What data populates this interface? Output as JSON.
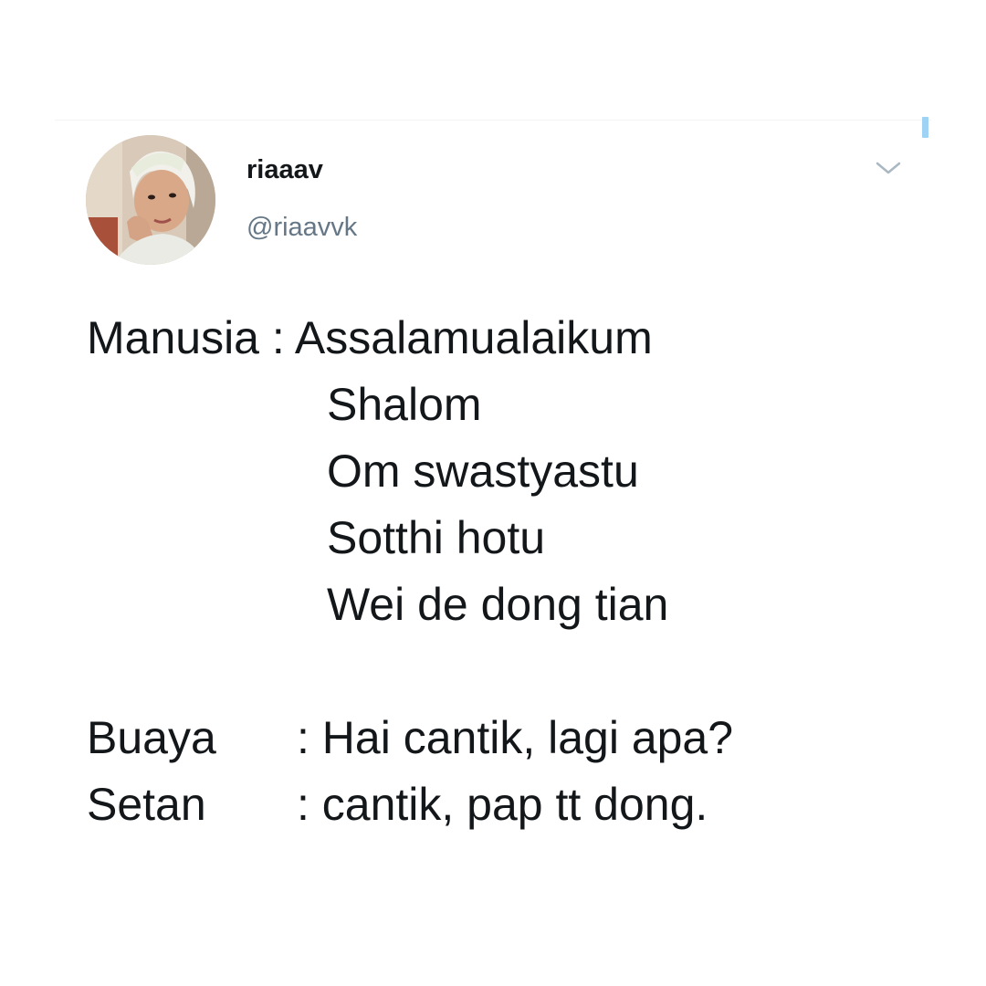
{
  "user": {
    "display_name": "riaaav",
    "handle": "@riaavvk",
    "avatar_icon": "profile-photo"
  },
  "controls": {
    "more_icon": "chevron-down-icon",
    "accent_color": "#1da1f2",
    "handle_color": "#657786"
  },
  "tweet": {
    "lines": [
      {
        "speaker": "Manusia :",
        "text": "Assalamualaikum"
      },
      {
        "speaker": "",
        "text": "Shalom"
      },
      {
        "speaker": "",
        "text": "Om swastyastu"
      },
      {
        "speaker": "",
        "text": "Sotthi hotu"
      },
      {
        "speaker": "",
        "text": "Wei de dong tian"
      },
      {
        "speaker": "Buaya",
        "text": ": Hai cantik, lagi apa?"
      },
      {
        "speaker": "Setan",
        "text": ": cantik, pap tt dong."
      }
    ]
  }
}
